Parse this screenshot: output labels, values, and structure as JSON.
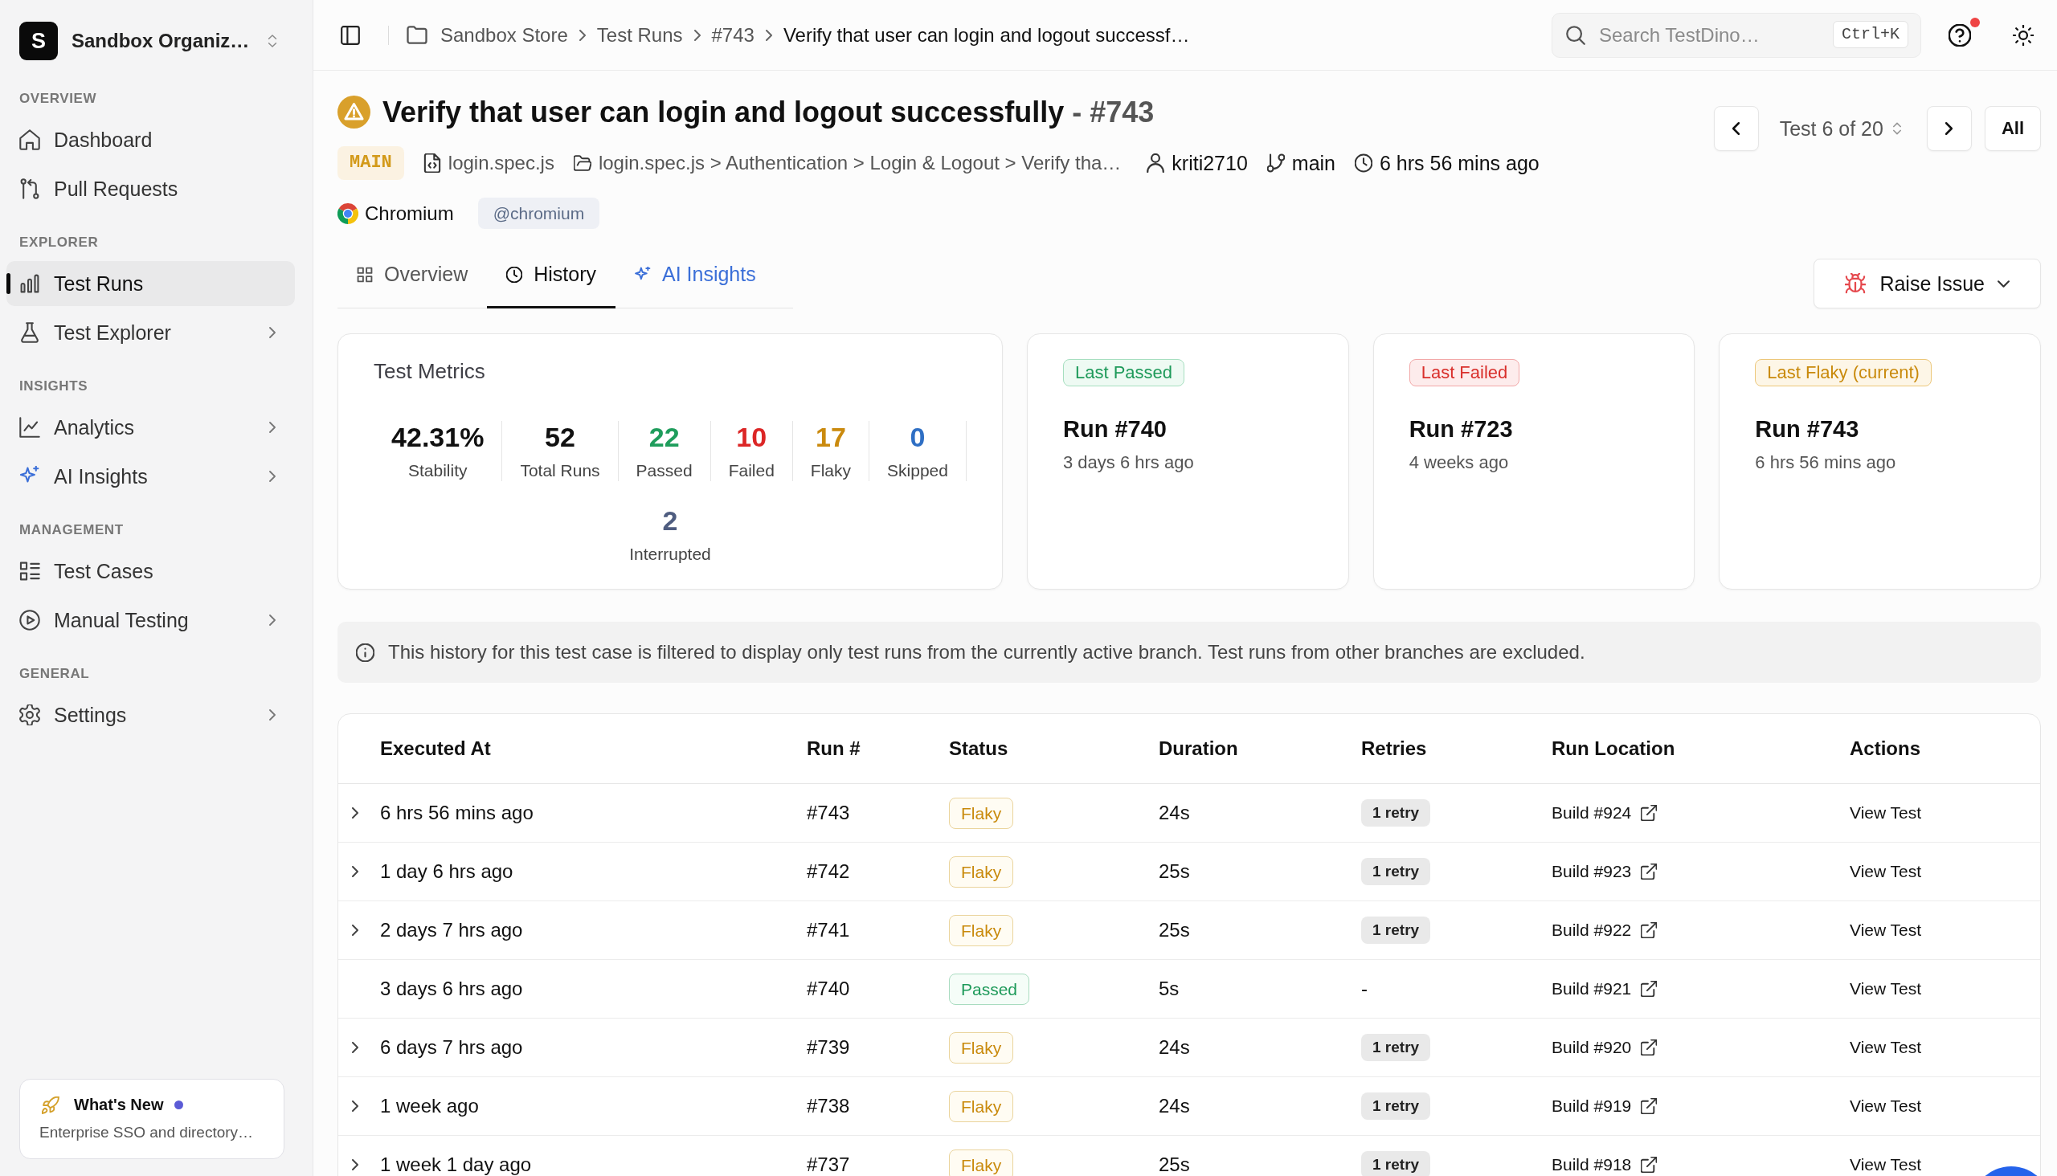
{
  "sidebar": {
    "org": {
      "initial": "S",
      "name": "Sandbox Organiz…"
    },
    "sections": [
      {
        "label": "OVERVIEW",
        "items": [
          {
            "label": "Dashboard",
            "kind": "home",
            "selected": false,
            "submenu": false
          },
          {
            "label": "Pull Requests",
            "kind": "pull",
            "selected": false,
            "submenu": false
          }
        ]
      },
      {
        "label": "EXPLORER",
        "items": [
          {
            "label": "Test Runs",
            "kind": "bars",
            "selected": true,
            "submenu": false
          },
          {
            "label": "Test Explorer",
            "kind": "flask",
            "selected": false,
            "submenu": true
          }
        ]
      },
      {
        "label": "INSIGHTS",
        "items": [
          {
            "label": "Analytics",
            "kind": "chart",
            "selected": false,
            "submenu": true
          },
          {
            "label": "AI Insights",
            "kind": "ai",
            "selected": false,
            "submenu": true
          }
        ]
      },
      {
        "label": "MANAGEMENT",
        "items": [
          {
            "label": "Test Cases",
            "kind": "list",
            "selected": false,
            "submenu": false
          },
          {
            "label": "Manual Testing",
            "kind": "play",
            "selected": false,
            "submenu": true
          }
        ]
      },
      {
        "label": "GENERAL",
        "items": [
          {
            "label": "Settings",
            "kind": "gear",
            "selected": false,
            "submenu": true
          }
        ]
      }
    ],
    "whats_new": {
      "title": "What's New",
      "text": "Enterprise SSO and directory…",
      "unread": true
    }
  },
  "topbar": {
    "breadcrumbs": [
      "Sandbox Store",
      "Test Runs",
      "#743",
      "Verify that user can login and logout successf…"
    ],
    "search": {
      "placeholder": "Search TestDino…",
      "shortcut": "Ctrl+K"
    },
    "help_unread": true
  },
  "test": {
    "title": "Verify that user can login and logout successfully",
    "run": "- #743",
    "branch_tag": "MAIN",
    "file": "login.spec.js",
    "path": "login.spec.js > Authentication > Login & Logout > Verify tha…",
    "author": "kriti2710",
    "branch": "main",
    "time": "6 hrs 56 mins ago",
    "browser": "Chromium",
    "browser_tag": "@chromium"
  },
  "pager": {
    "label": "Test 6 of 20",
    "all": "All"
  },
  "tabs": [
    {
      "label": "Overview",
      "kind": "grid",
      "selected": false
    },
    {
      "label": "History",
      "kind": "clock",
      "selected": true
    },
    {
      "label": "AI Insights",
      "kind": "ai",
      "selected": false
    }
  ],
  "raise_issue": "Raise Issue",
  "metrics": {
    "title": "Test Metrics",
    "items": [
      {
        "value": "42.31%",
        "label": "Stability",
        "color": "#111111"
      },
      {
        "value": "52",
        "label": "Total Runs",
        "color": "#111111"
      },
      {
        "value": "22",
        "label": "Passed",
        "color": "#1f9d5c"
      },
      {
        "value": "10",
        "label": "Failed",
        "color": "#dc2626"
      },
      {
        "value": "17",
        "label": "Flaky",
        "color": "#ca8a0e"
      },
      {
        "value": "0",
        "label": "Skipped",
        "color": "#2f6fc4"
      },
      {
        "value": "2",
        "label": "Interrupted",
        "color": "#4f5d80"
      }
    ]
  },
  "last_runs": [
    {
      "badge": "Last Passed",
      "kind": "passed",
      "run": "Run #740",
      "time": "3 days 6 hrs ago"
    },
    {
      "badge": "Last Failed",
      "kind": "failed",
      "run": "Run #723",
      "time": "4 weeks ago"
    },
    {
      "badge": "Last Flaky (current)",
      "kind": "flaky",
      "run": "Run #743",
      "time": "6 hrs 56 mins ago"
    }
  ],
  "notice": "This history for this test case is filtered to display only test runs from the currently active branch. Test runs from other branches are excluded.",
  "table": {
    "columns": [
      "Executed At",
      "Run #",
      "Status",
      "Duration",
      "Retries",
      "Run Location",
      "Actions"
    ],
    "rows": [
      {
        "kind": "flaky",
        "expandable": true,
        "executed_at": "6 hrs 56 mins ago",
        "run": "#743",
        "status": "Flaky",
        "duration": "24s",
        "retries": "1 retry",
        "retried": true,
        "location": "Build #924",
        "action": "View Test"
      },
      {
        "kind": "flaky",
        "expandable": true,
        "executed_at": "1 day 6 hrs ago",
        "run": "#742",
        "status": "Flaky",
        "duration": "25s",
        "retries": "1 retry",
        "retried": true,
        "location": "Build #923",
        "action": "View Test"
      },
      {
        "kind": "flaky",
        "expandable": true,
        "executed_at": "2 days 7 hrs ago",
        "run": "#741",
        "status": "Flaky",
        "duration": "25s",
        "retries": "1 retry",
        "retried": true,
        "location": "Build #922",
        "action": "View Test"
      },
      {
        "kind": "passed",
        "expandable": false,
        "executed_at": "3 days 6 hrs ago",
        "run": "#740",
        "status": "Passed",
        "duration": "5s",
        "retries": "-",
        "retried": false,
        "location": "Build #921",
        "action": "View Test"
      },
      {
        "kind": "flaky",
        "expandable": true,
        "executed_at": "6 days 7 hrs ago",
        "run": "#739",
        "status": "Flaky",
        "duration": "24s",
        "retries": "1 retry",
        "retried": true,
        "location": "Build #920",
        "action": "View Test"
      },
      {
        "kind": "flaky",
        "expandable": true,
        "executed_at": "1 week ago",
        "run": "#738",
        "status": "Flaky",
        "duration": "24s",
        "retries": "1 retry",
        "retried": true,
        "location": "Build #919",
        "action": "View Test"
      },
      {
        "kind": "flaky",
        "expandable": true,
        "executed_at": "1 week 1 day ago",
        "run": "#737",
        "status": "Flaky",
        "duration": "25s",
        "retries": "1 retry",
        "retried": true,
        "location": "Build #918",
        "action": "View Test"
      }
    ]
  }
}
